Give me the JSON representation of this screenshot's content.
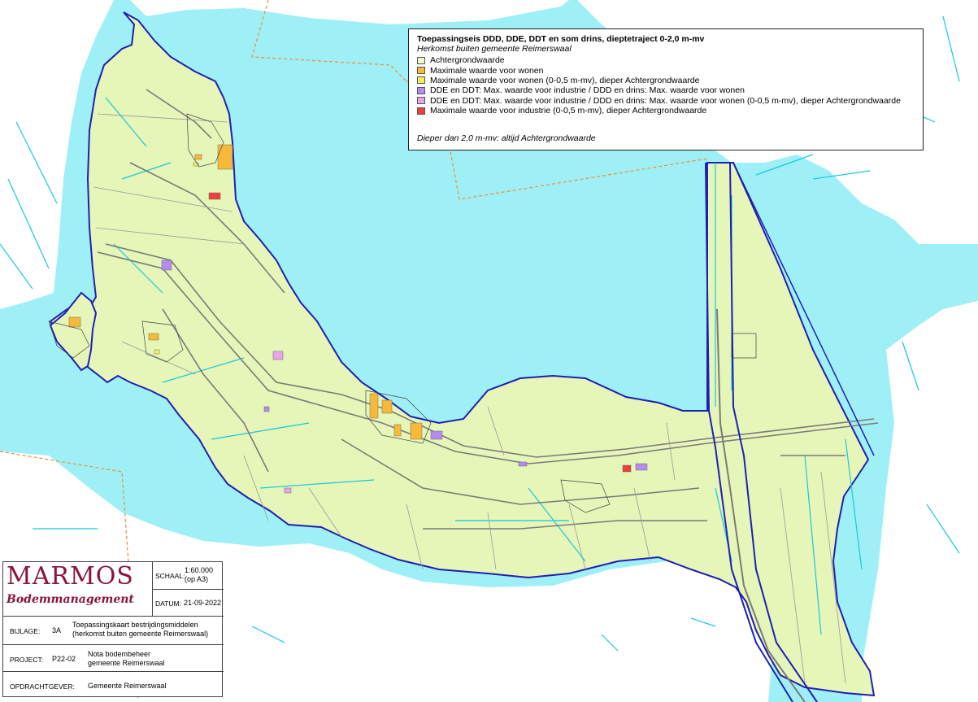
{
  "colors": {
    "water": "#9ff0f6",
    "land": "#e6f5b8",
    "achtergrond": "#eefac8",
    "wonen": "#f7b93a",
    "wonen_05": "#f1f05b",
    "industrie_wonen": "#b48cf0",
    "industrie_wonen_05": "#e8a5ea",
    "industrie_05": "#ef3f3f",
    "boundary": "#1f1fb4",
    "road": "#7a7a7a",
    "ditch": "#18c8dc",
    "municipal": "#f08a3a",
    "logo": "#8a1538"
  },
  "legend": {
    "title": "Toepassingseis DDD, DDE, DDT en som drins, dieptetraject 0-2,0 m-mv",
    "subtitle": "Herkomst buiten gemeente Reimerswaal",
    "items": [
      {
        "label": "Achtergrondwaarde",
        "color": "#eefac8"
      },
      {
        "label": "Maximale waarde voor wonen",
        "color": "#f7b93a"
      },
      {
        "label": "Maximale waarde voor wonen (0-0,5 m-mv), dieper Achtergrondwaarde",
        "color": "#f1f05b"
      },
      {
        "label": "DDE en DDT: Max. waarde voor industrie / DDD en drins: Max. waarde voor wonen",
        "color": "#b48cf0"
      },
      {
        "label": "DDE en DDT: Max. waarde voor industrie / DDD en drins: Max. waarde voor wonen (0-0,5 m-mv), dieper Achtergrondwaarde",
        "color": "#e8a5ea"
      },
      {
        "label": "Maximale waarde voor industrie (0-0,5 m-mv), dieper Achtergrondwaarde",
        "color": "#ef3f3f"
      }
    ],
    "note": "Dieper dan 2,0 m-mv: altijd Achtergrondwaarde"
  },
  "titleblock": {
    "logo_main": "MARMOS",
    "logo_sub": "Bodemmanagement",
    "schaal_label": "SCHAAL:",
    "schaal_value": "1:60.000",
    "schaal_note": "(op A3)",
    "datum_label": "DATUM:",
    "datum_value": "21-09-2022",
    "bijlage_label": "BIJLAGE:",
    "bijlage_value": "3A",
    "bijlage_text1": "Toepassingskaart bestrijdingsmiddelen",
    "bijlage_text2": "(herkomst buiten gemeente Reimerswaal)",
    "project_label": "PROJECT:",
    "project_value": "P22-02",
    "project_text1": "Nota bodembeheer",
    "project_text2": "gemeente Reimerswaal",
    "opdrachtgever_label": "OPDRACHTGEVER:",
    "opdrachtgever_value": "Gemeente Reimerswaal"
  }
}
